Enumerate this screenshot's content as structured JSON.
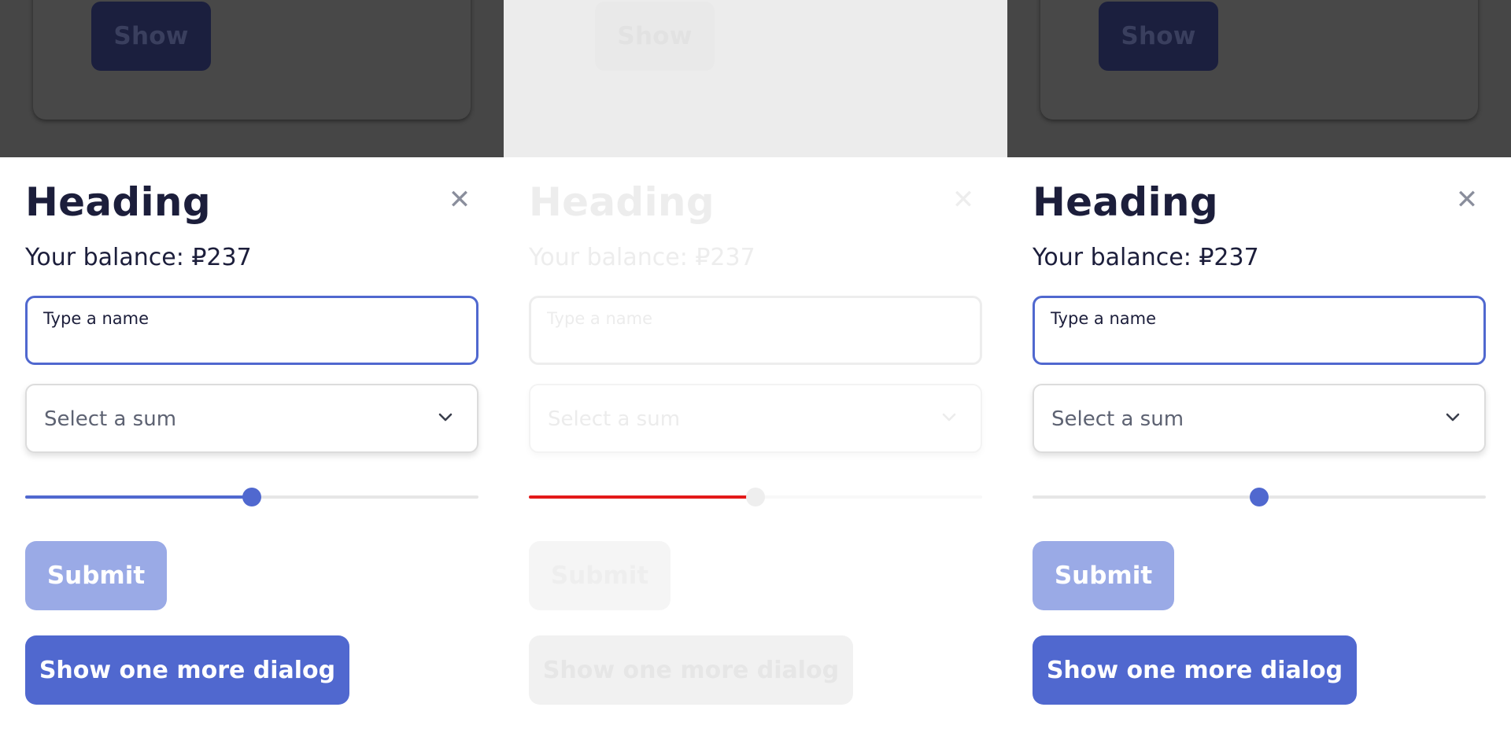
{
  "colors": {
    "accent": "#5068cf",
    "accent_light": "#9aaae6",
    "heading": "#1c1e3b",
    "backdrop_dark": "#464646",
    "backdrop_light": "#ececec",
    "slider_fill_disabled": "#e31919"
  },
  "panels": [
    {
      "state": "default",
      "backdrop_button_label": "Show",
      "heading": "Heading",
      "close_icon": "close-icon",
      "balance": "Your balance: ₽237",
      "name_input": {
        "placeholder": "Type a name",
        "value": ""
      },
      "select": {
        "label": "Select a sum",
        "icon": "chevron-down-icon"
      },
      "slider": {
        "value_percent": 50
      },
      "submit_label": "Submit",
      "more_label": "Show one more dialog"
    },
    {
      "state": "disabled",
      "backdrop_button_label": "Show",
      "heading": "Heading",
      "close_icon": "close-icon",
      "balance": "Your balance: ₽237",
      "name_input": {
        "placeholder": "Type a name",
        "value": ""
      },
      "select": {
        "label": "Select a sum",
        "icon": "chevron-down-icon"
      },
      "slider": {
        "value_percent": 50
      },
      "submit_label": "Submit",
      "more_label": "Show one more dialog"
    },
    {
      "state": "default",
      "backdrop_button_label": "Show",
      "heading": "Heading",
      "close_icon": "close-icon",
      "balance": "Your balance: ₽237",
      "name_input": {
        "placeholder": "Type a name",
        "value": ""
      },
      "select": {
        "label": "Select a sum",
        "icon": "chevron-down-icon"
      },
      "slider": {
        "value_percent": 50
      },
      "submit_label": "Submit",
      "more_label": "Show one more dialog"
    }
  ]
}
